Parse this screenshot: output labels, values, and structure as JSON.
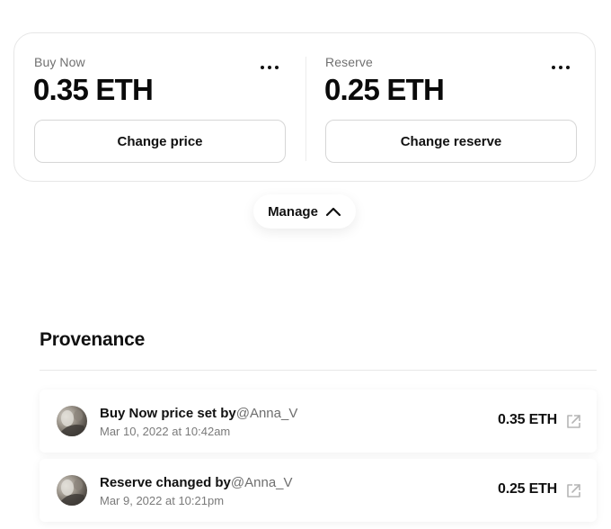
{
  "pricing": {
    "buy_now": {
      "label": "Buy Now",
      "value": "0.35 ETH",
      "button_label": "Change price",
      "more_icon": "more-horizontal-icon"
    },
    "reserve": {
      "label": "Reserve",
      "value": "0.25 ETH",
      "button_label": "Change reserve",
      "more_icon": "more-horizontal-icon"
    }
  },
  "manage": {
    "label": "Manage",
    "icon": "chevron-up-icon",
    "expanded": true
  },
  "provenance": {
    "title": "Provenance",
    "items": [
      {
        "event": "Buy Now price set by",
        "user": "@Anna_V",
        "date": "Mar 10, 2022 at 10:42am",
        "amount": "0.35 ETH",
        "link_icon": "external-link-icon"
      },
      {
        "event": "Reserve changed by",
        "user": "@Anna_V",
        "date": "Mar 9, 2022 at 10:21pm",
        "amount": "0.25 ETH",
        "link_icon": "external-link-icon"
      }
    ]
  },
  "colors": {
    "text_primary": "#111111",
    "text_secondary": "#707070",
    "border": "#e6e6e6",
    "background": "#ffffff"
  }
}
